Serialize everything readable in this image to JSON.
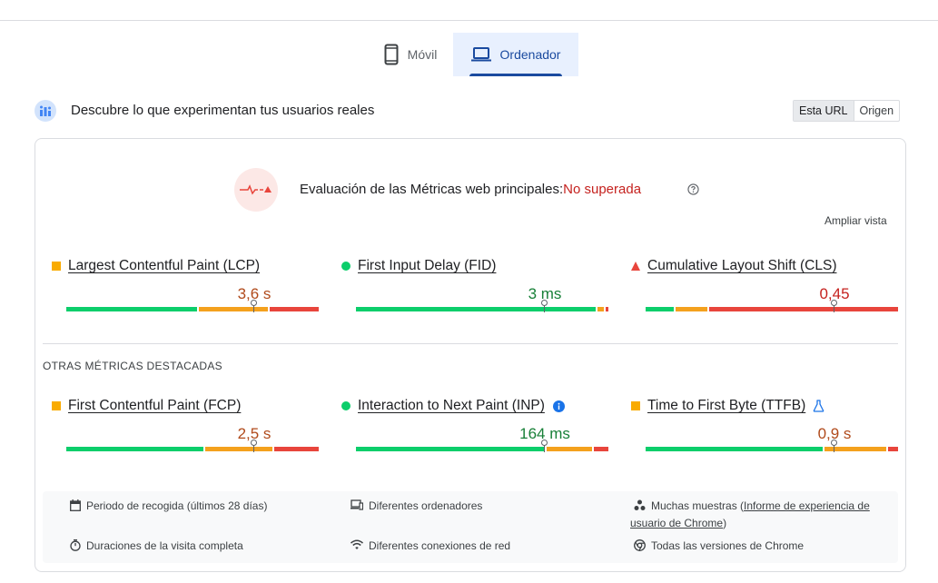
{
  "tabs": {
    "mobile": "Móvil",
    "desktop": "Ordenador"
  },
  "section": {
    "title": "Descubre lo que experimentan tus usuarios reales",
    "scope": {
      "url": "Esta URL",
      "origin": "Origen"
    }
  },
  "assessment": {
    "label": "Evaluación de las Métricas web principales:",
    "result": "No superada",
    "expand": "Ampliar vista"
  },
  "core_metrics": [
    {
      "name": "Largest Contentful Paint (LCP)",
      "value": "3,6 s",
      "status": "needs-improvement",
      "marker": 0.74
    },
    {
      "name": "First Input Delay (FID)",
      "value": "3 ms",
      "status": "good",
      "marker": 0.75
    },
    {
      "name": "Cumulative Layout Shift (CLS)",
      "value": "0,45",
      "status": "poor",
      "marker": 0.75
    }
  ],
  "other_title": "OTRAS MÉTRICAS DESTACADAS",
  "other_metrics": [
    {
      "name": "First Contentful Paint (FCP)",
      "value": "2,5 s",
      "status": "needs-improvement",
      "marker": 0.74
    },
    {
      "name": "Interaction to Next Paint (INP)",
      "value": "164 ms",
      "status": "good",
      "marker": 0.75
    },
    {
      "name": "Time to First Byte (TTFB)",
      "value": "0,9 s",
      "status": "needs-improvement",
      "marker": 0.75
    }
  ],
  "info": {
    "period": "Periodo de recogida (últimos 28 días)",
    "devices": "Diferentes ordenadores",
    "samples_prefix": "Muchas muestras (",
    "samples_link_1": "Informe de experiencia de",
    "samples_link_2": "usuario de Chrome",
    "samples_suffix": ")",
    "duration": "Duraciones de la visita completa",
    "network": "Diferentes conexiones de red",
    "versions": "Todas las versiones de Chrome"
  },
  "colors": {
    "good": "#0cce6b",
    "needs_improvement": "#f4a11d",
    "poor": "#e8453c",
    "accent": "#1a4a9f"
  }
}
